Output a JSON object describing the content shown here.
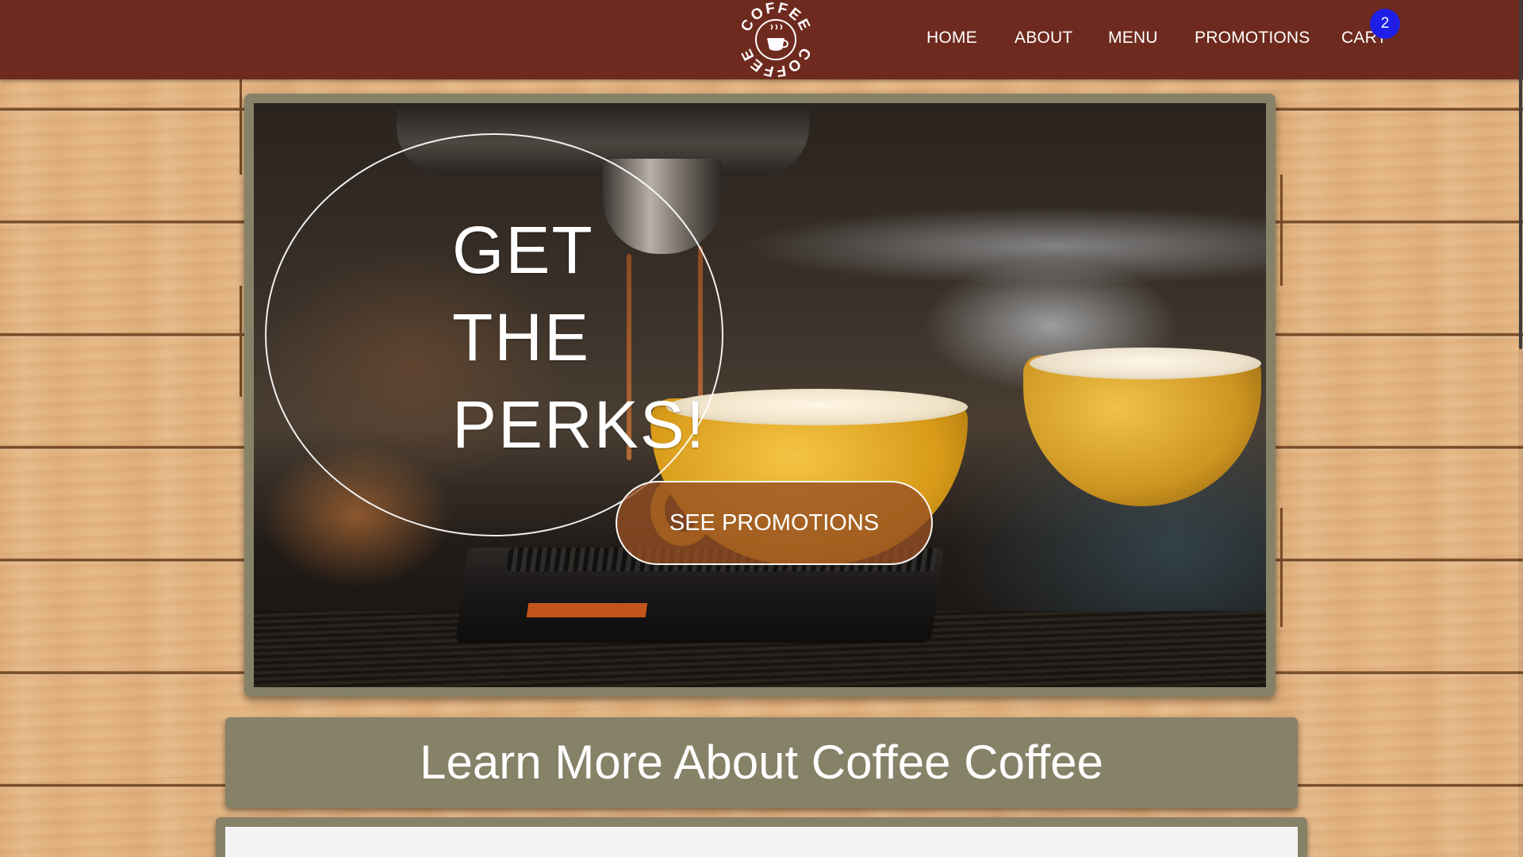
{
  "brand": {
    "logo_text_top": "COFFEE",
    "logo_text_bottom": "COFFEE"
  },
  "nav": {
    "items": [
      {
        "label": "HOME"
      },
      {
        "label": "ABOUT"
      },
      {
        "label": "MENU"
      },
      {
        "label": "PROMOTIONS"
      },
      {
        "label": "CART"
      }
    ],
    "cart_count": "2"
  },
  "hero": {
    "title_lines": [
      "GET",
      "THE",
      "PERKS!"
    ],
    "button_label": "SEE PROMOTIONS"
  },
  "about": {
    "heading": "Learn More About Coffee Coffee"
  },
  "colors": {
    "header_bg": "#6e2a1e",
    "frame": "#868268",
    "badge": "#1e1ee6",
    "button_bg": "#96502a"
  },
  "icons": {
    "logo": "coffee-cup-logo-icon"
  }
}
